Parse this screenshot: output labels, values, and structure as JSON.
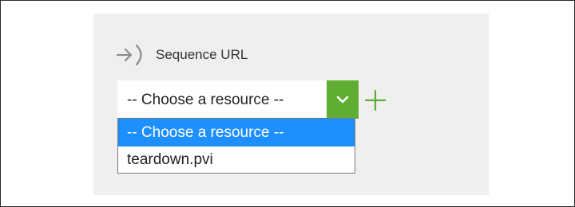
{
  "field": {
    "icon": "input-arrow-icon",
    "label": "Sequence URL"
  },
  "select": {
    "value": "-- Choose a resource --",
    "toggle_icon": "chevron-down-icon",
    "accent_color": "#5fae32"
  },
  "add_button": {
    "icon": "plus-icon",
    "color": "#5fae32"
  },
  "dropdown": {
    "highlight_color": "#1e8fff",
    "options": [
      {
        "label": "-- Choose a resource --",
        "selected": true
      },
      {
        "label": "teardown.pvi",
        "selected": false
      }
    ]
  }
}
